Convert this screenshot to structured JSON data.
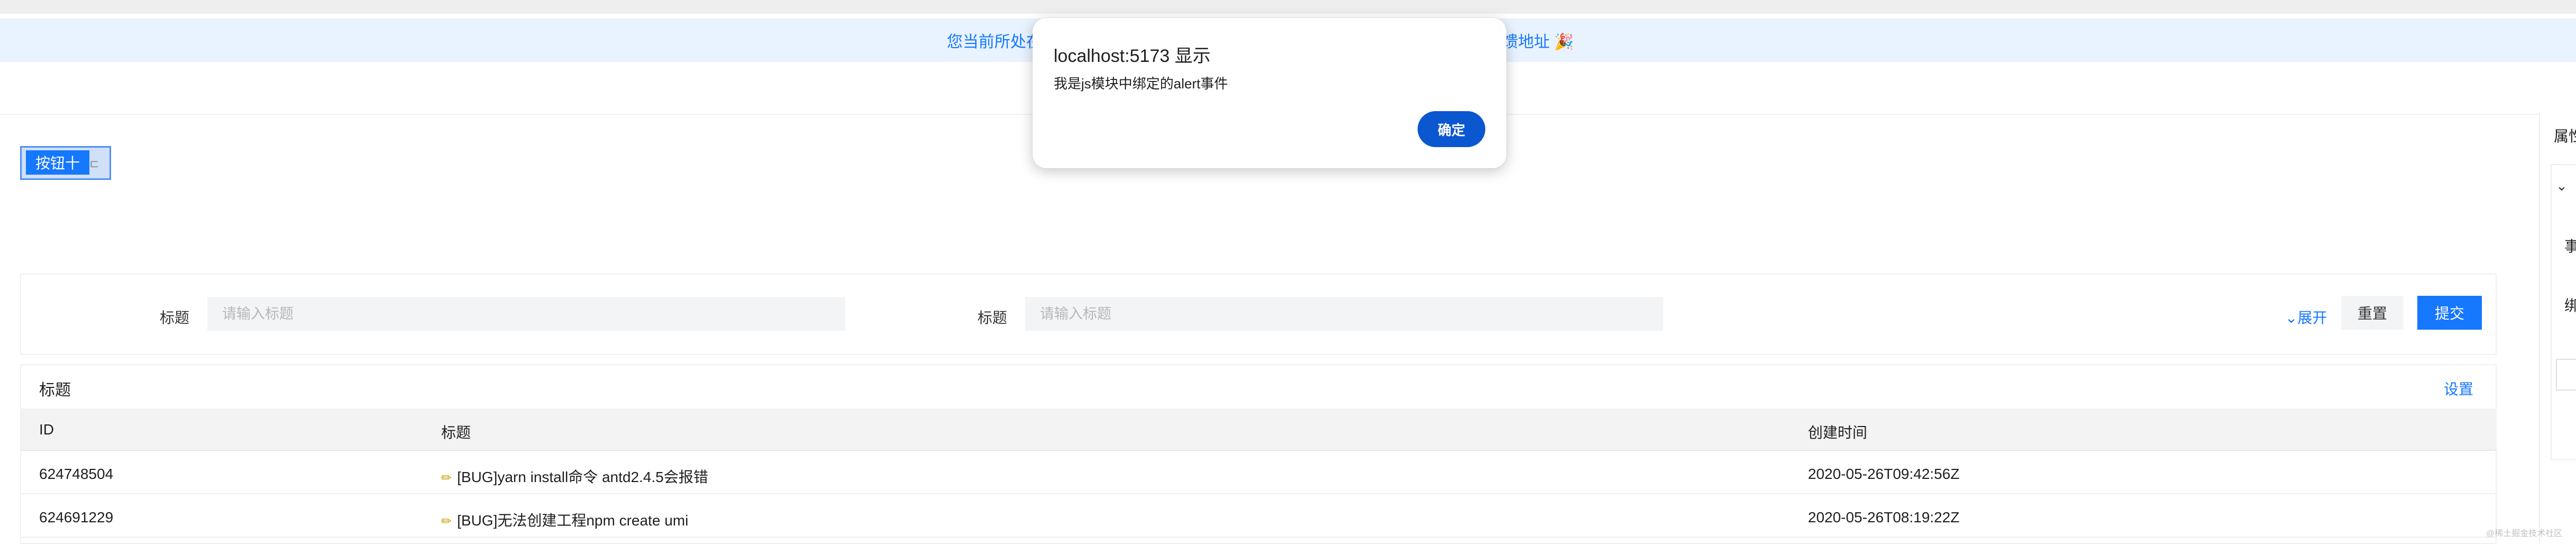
{
  "notice": {
    "left_text": "您当前所处在",
    "right_text": "馈地址 🎉"
  },
  "selected_element": {
    "button_label": "按钮十",
    "ghost_label": "ㄷ"
  },
  "search_form": {
    "fields": [
      {
        "label": "标题",
        "placeholder": "请输入标题"
      },
      {
        "label": "标题",
        "placeholder": "请输入标题"
      }
    ],
    "expand_icon": "double-chevron-down-icon",
    "expand_label": "展开",
    "reset_label": "重置",
    "submit_label": "提交"
  },
  "table": {
    "title": "标题",
    "settings_label": "设置",
    "columns": [
      "ID",
      "标题",
      "创建时间"
    ],
    "rows": [
      {
        "id": "624748504",
        "icon": "pencil-icon",
        "title": "[BUG]yarn install命令 antd2.4.5会报错",
        "created": "2020-05-26T09:42:56Z"
      },
      {
        "id": "624691229",
        "icon": "pencil-icon",
        "title": "[BUG]无法创建工程npm create umi",
        "created": "2020-05-26T08:19:22Z"
      }
    ]
  },
  "right_panel": {
    "title": "属性",
    "item1": "事",
    "item2": "绑"
  },
  "watermark": "@稀土掘金技术社区",
  "alert_dialog": {
    "title": "localhost:5173 显示",
    "message": "我是js模块中绑定的alert事件",
    "ok_label": "确定"
  },
  "colors": {
    "primary": "#1677ff",
    "dialog_button": "#0b57d0",
    "notice_bg": "#e8f3ff"
  }
}
